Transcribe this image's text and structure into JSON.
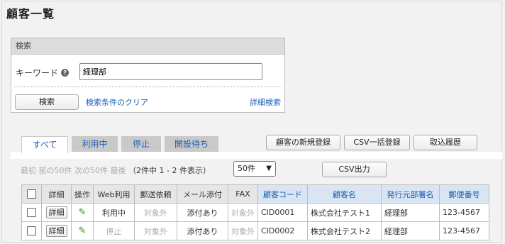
{
  "page": {
    "title": "顧客一覧"
  },
  "search": {
    "header": "検索",
    "keyword_label": "キーワード",
    "keyword_value": "経理部",
    "search_button": "検索",
    "clear_link": "検索条件のクリア",
    "advanced_link": "詳細検索"
  },
  "tabs": [
    {
      "label": "すべて",
      "active": true
    },
    {
      "label": "利用中",
      "active": false
    },
    {
      "label": "停止",
      "active": false
    },
    {
      "label": "開設待ち",
      "active": false
    }
  ],
  "toolbar": {
    "new_button": "顧客の新規登録",
    "csv_bulk_button": "CSV一括登録",
    "history_button": "取込履歴"
  },
  "pager": {
    "first": "最初",
    "prev": "前の50件",
    "next": "次の50件",
    "last": "最後",
    "count_text": "（2件中 1 - 2 件表示）",
    "per_page": "50件",
    "csv_output": "CSV出力"
  },
  "table": {
    "headers": [
      "",
      "詳細",
      "操作",
      "Web利用",
      "郵送依頼",
      "メール添付",
      "FAX",
      "顧客コード",
      "顧客名",
      "発行元部署名",
      "郵便番号"
    ],
    "rows": [
      {
        "detail": "詳細",
        "web": "利用中",
        "mail": "対象外",
        "email": "添付あり",
        "fax": "対象外",
        "code": "CID0001",
        "name": "株式会社テスト1",
        "dept": "経理部",
        "zip": "123-4567"
      },
      {
        "detail": "詳細",
        "web": "停止",
        "mail": "対象外",
        "email": "添付あり",
        "fax": "対象外",
        "code": "CID0002",
        "name": "株式会社テスト2",
        "dept": "経理部",
        "zip": "123-4567"
      }
    ]
  },
  "colors": {
    "link": "#1a5fb4",
    "header_blue": "#d9e5f2",
    "pencil": "#3a8a1f"
  }
}
